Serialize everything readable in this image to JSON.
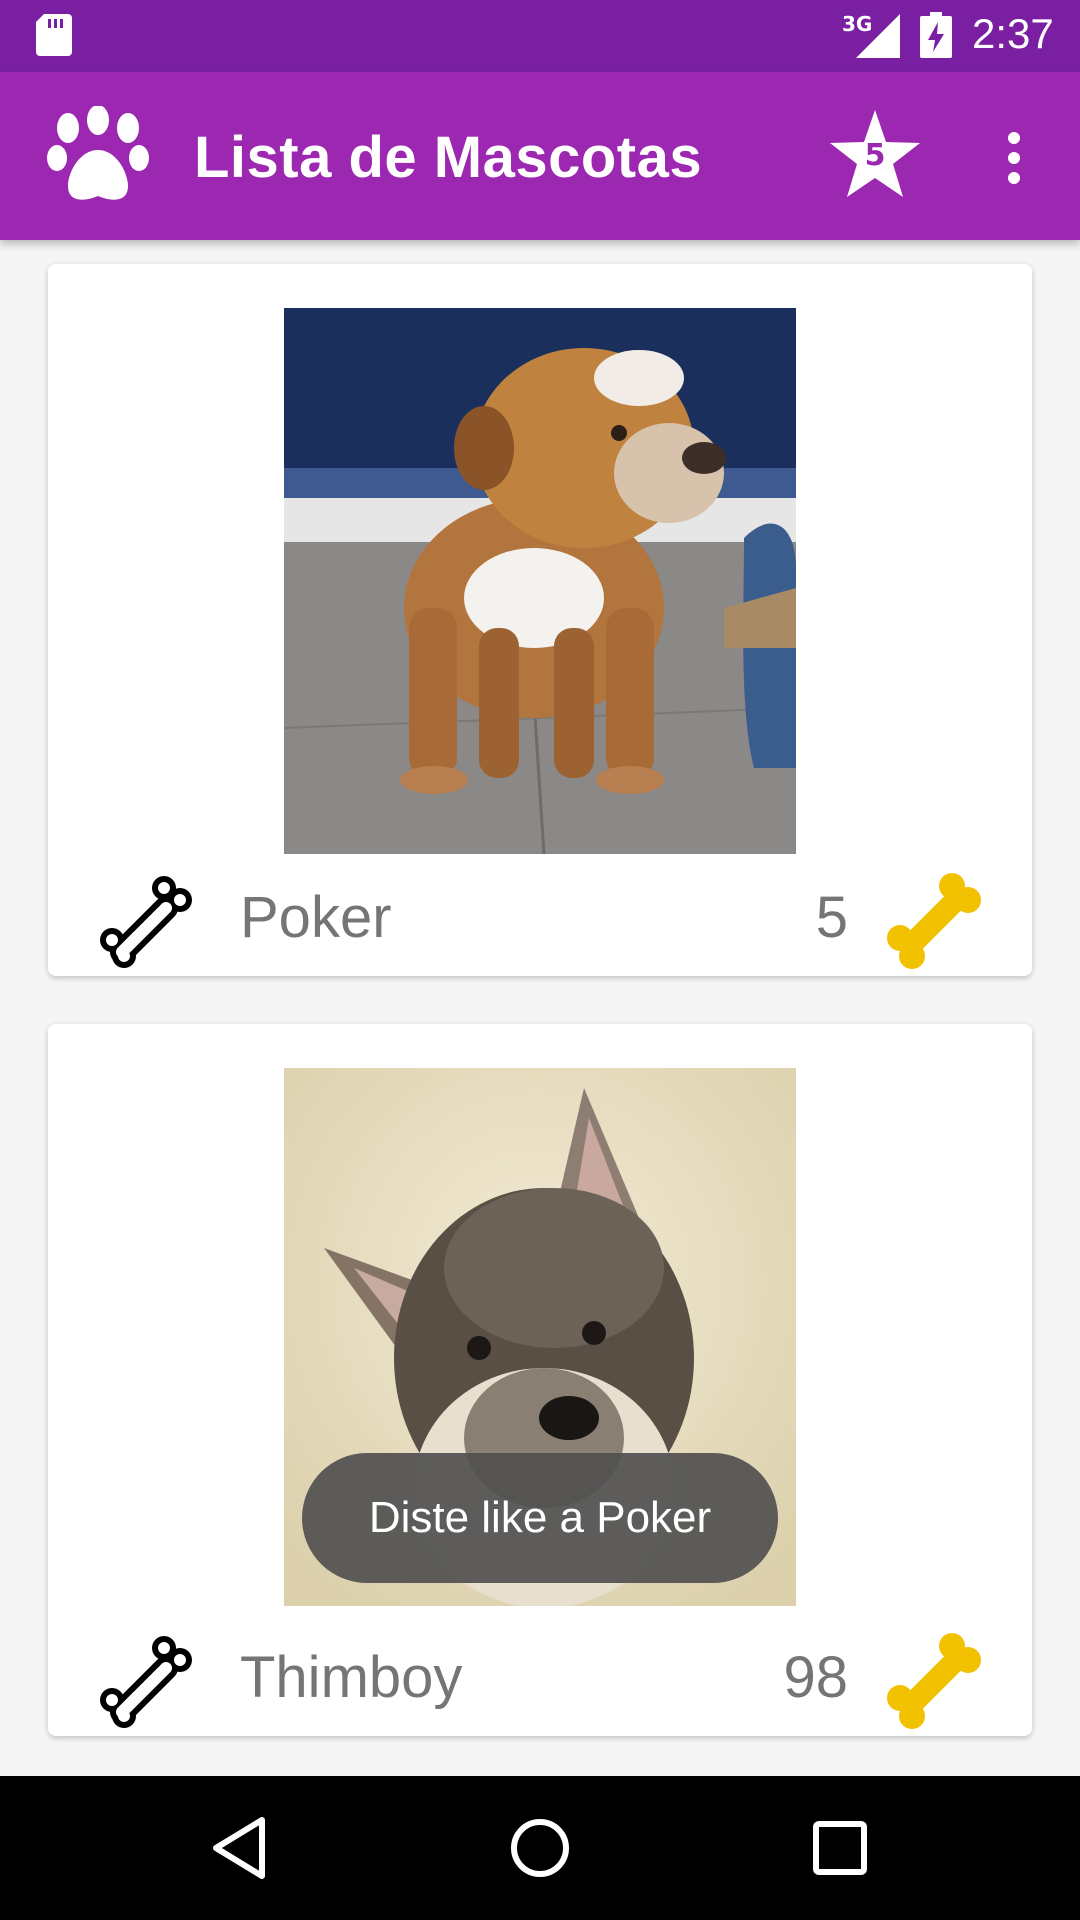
{
  "status_bar": {
    "network": "3G",
    "time": "2:37"
  },
  "app_bar": {
    "title": "Lista de Mascotas",
    "favorites_count": "5"
  },
  "pets": [
    {
      "name": "Poker",
      "likes": "5"
    },
    {
      "name": "Thimboy",
      "likes": "98"
    }
  ],
  "toast": {
    "message": "Diste like a Poker"
  },
  "colors": {
    "status_bar": "#7b1fa2",
    "app_bar": "#9c27b0",
    "rating_bone": "#f2c200",
    "text_secondary": "#757575"
  },
  "icons": {
    "app_logo": "paw-icon",
    "favorites": "star-icon",
    "menu": "more-vert-icon",
    "like": "bone-outline-icon",
    "rating": "bone-filled-icon",
    "nav_back": "triangle-back-icon",
    "nav_home": "circle-home-icon",
    "nav_recents": "square-recents-icon"
  }
}
